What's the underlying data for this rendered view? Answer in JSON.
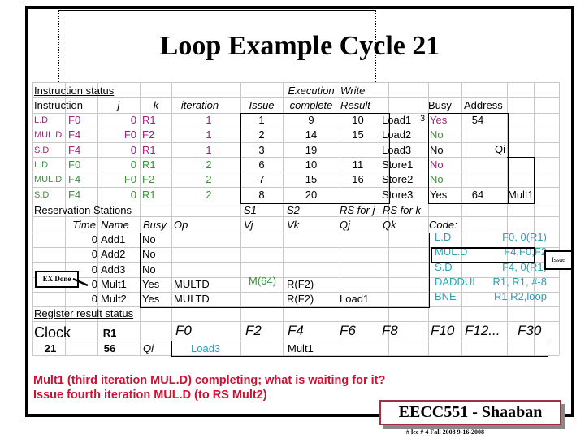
{
  "title": "Loop Example Cycle 21",
  "instruction_status": {
    "section_label": "Instruction status",
    "headers": {
      "instruction": "Instruction",
      "j": "j",
      "k": "k",
      "iteration": "iteration",
      "issue": "Issue",
      "exec_top": "Execution",
      "exec_bottom": "complete",
      "write_top": "Write",
      "write_bottom": "Result"
    },
    "rows": [
      {
        "op": "L.D",
        "dest": "F0",
        "j": "0",
        "k": "R1",
        "iteration": "1",
        "issue": "1",
        "exec": "9",
        "write": "10",
        "color": "#a0207a"
      },
      {
        "op": "MUL.D",
        "dest": "F4",
        "j": "F0",
        "k": "F2",
        "iteration": "1",
        "issue": "2",
        "exec": "14",
        "write": "15",
        "color": "#a0207a"
      },
      {
        "op": "S.D",
        "dest": "F4",
        "j": "0",
        "k": "R1",
        "iteration": "1",
        "issue": "3",
        "exec": "19",
        "write": "",
        "color": "#a0207a"
      },
      {
        "op": "L.D",
        "dest": "F0",
        "j": "0",
        "k": "R1",
        "iteration": "2",
        "issue": "6",
        "exec": "10",
        "write": "11",
        "color": "#3d8f3d"
      },
      {
        "op": "MUL.D",
        "dest": "F4",
        "j": "F0",
        "k": "F2",
        "iteration": "2",
        "issue": "7",
        "exec": "15",
        "write": "16",
        "color": "#3d8f3d"
      },
      {
        "op": "S.D",
        "dest": "F4",
        "j": "0",
        "k": "R1",
        "iteration": "2",
        "issue": "8",
        "exec": "20",
        "write": "",
        "color": "#3d8f3d"
      }
    ]
  },
  "load_store_buffers": {
    "headers": {
      "busy": "Busy",
      "address": "Address",
      "qi": "Qi"
    },
    "annotation": "3",
    "rows": [
      {
        "name": "Load1",
        "busy": "Yes",
        "address": "54",
        "qi": "",
        "busy_color": "#a0207a"
      },
      {
        "name": "Load2",
        "busy": "No",
        "address": "",
        "qi": "",
        "busy_color": "#3d8f3d"
      },
      {
        "name": "Load3",
        "busy": "No",
        "address": "",
        "qi": "",
        "busy_color": "#000000"
      },
      {
        "name": "Store1",
        "busy": "No",
        "address": "",
        "qi": "",
        "busy_color": "#a0207a"
      },
      {
        "name": "Store2",
        "busy": "No",
        "address": "",
        "qi": "",
        "busy_color": "#3d8f3d"
      },
      {
        "name": "Store3",
        "busy": "Yes",
        "address": "64",
        "qi": "Mult1",
        "busy_color": "#000000"
      }
    ]
  },
  "reservation_stations": {
    "section_label": "Reservation Stations",
    "headers_top": {
      "s1": "S1",
      "s2": "S2",
      "rs_j": "RS for j",
      "rs_k": "RS for k"
    },
    "headers": {
      "time": "Time",
      "name": "Name",
      "busy": "Busy",
      "op": "Op",
      "vj": "Vj",
      "vk": "Vk",
      "qj": "Qj",
      "qk": "Qk"
    },
    "rows": [
      {
        "time": "0",
        "name": "Add1",
        "busy": "No",
        "op": "",
        "vj": "",
        "vk": "",
        "qj": "",
        "qk": ""
      },
      {
        "time": "0",
        "name": "Add2",
        "busy": "No",
        "op": "",
        "vj": "",
        "vk": "",
        "qj": "",
        "qk": ""
      },
      {
        "time": "0",
        "name": "Add3",
        "busy": "No",
        "op": "",
        "vj": "",
        "vk": "",
        "qj": "",
        "qk": ""
      },
      {
        "time": "0",
        "name": "Mult1",
        "busy": "Yes",
        "op": "MULTD",
        "vj": "M(64)",
        "vk": "R(F2)",
        "qj": "",
        "qk": ""
      },
      {
        "time": "0",
        "name": "Mult2",
        "busy": "Yes",
        "op": "MULTD",
        "vj": "",
        "vk": "R(F2)",
        "qj": "Load1",
        "qk": ""
      }
    ],
    "ex_done_callout": "EX Done"
  },
  "code": {
    "label": "Code:",
    "lines": [
      {
        "op": "L.D",
        "args": "F0, 0(R1)"
      },
      {
        "op": "MUL.D",
        "args": "F4,F0,F2"
      },
      {
        "op": "S.D",
        "args": "F4, 0(R1)"
      },
      {
        "op": "DADDUI",
        "args": "R1, R1, #-8"
      },
      {
        "op": "BNE",
        "args": "R1,R2,loop"
      }
    ],
    "issue_callout": "Issue"
  },
  "register_result_status": {
    "section_label": "Register result status",
    "clock_label": "Clock",
    "clock_value": "21",
    "r1_label": "R1",
    "r1_value": "56",
    "qi_label": "Qi",
    "registers": [
      "F0",
      "F2",
      "F4",
      "F6",
      "F8",
      "F10",
      "F12...",
      "F30"
    ],
    "qi_values": [
      "Load3",
      "",
      "Mult1",
      "",
      "",
      "",
      "",
      ""
    ]
  },
  "notes": [
    "Mult1 (third iteration MUL.D) completing; what is waiting for it?",
    "Issue fourth iteration MUL.D  (to RS Mult2)"
  ],
  "footer": {
    "badge": "EECC551 - Shaaban",
    "subtitle": "#  lec # 4  Fall 2008    9-16-2008"
  }
}
